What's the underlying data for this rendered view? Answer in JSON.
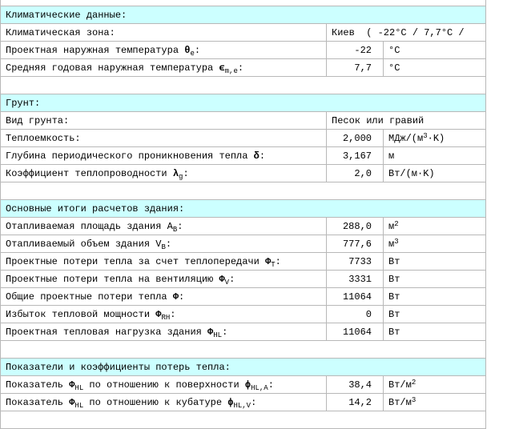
{
  "sections": [
    {
      "title": "Климатические данные:",
      "rows": [
        {
          "label": "Климатическая зона:",
          "span_value": "Киев  ( -22°C / 7,7°C /"
        },
        {
          "label": "Проектная наружная температура ",
          "sym": "θ",
          "sub": "e",
          "suffix": ":",
          "value": "-22",
          "unit": "°C"
        },
        {
          "label": "Средняя годовая наружная температура ",
          "sym": "ϵ",
          "sub": "m,e",
          "suffix": ":",
          "value": "7,7",
          "unit": "°C"
        }
      ]
    },
    {
      "title": "Грунт:",
      "rows": [
        {
          "label": "Вид грунта:",
          "span_value": "Песок или гравий"
        },
        {
          "label": "Теплоемкость:",
          "value": "2,000",
          "unit": "МДж/(м",
          "unit_sup": "3",
          "unit_tail": "·K)"
        },
        {
          "label": "Глубина периодического проникновения тепла ",
          "sym": "δ",
          "suffix": ":",
          "value": "3,167",
          "unit": "м"
        },
        {
          "label": "Коэффициент теплопроводности ",
          "sym": "λ",
          "sub": "g",
          "suffix": ":",
          "value": "2,0",
          "unit": "Вт/(м·K)"
        }
      ]
    },
    {
      "title": "Основные итоги расчетов здания:",
      "rows": [
        {
          "label": "Отапливаемая площадь здания A",
          "sub": "B",
          "suffix": ":",
          "value": "288,0",
          "unit": "м",
          "unit_sup": "2"
        },
        {
          "label": "Отапливаемый объем здания V",
          "sub": "B",
          "suffix": ":",
          "value": "777,6",
          "unit": "м",
          "unit_sup": "3"
        },
        {
          "label": "Проектные потери тепла за счет теплопередачи ",
          "sym": "Φ",
          "sub": "T",
          "suffix": ":",
          "value": "7733",
          "unit": "Вт"
        },
        {
          "label": "Проектные потери тепла на вентиляцию ",
          "sym": "Φ",
          "sub": "V",
          "suffix": ":",
          "value": "3331",
          "unit": "Вт"
        },
        {
          "label": "Общие проектные потери тепла ",
          "sym": "Φ",
          "suffix": ":",
          "value": "11064",
          "unit": "Вт"
        },
        {
          "label": "Избыток тепловой мощности ",
          "sym": "Φ",
          "sub": "RH",
          "suffix": ":",
          "value": "0",
          "unit": "Вт"
        },
        {
          "label": "Проектная тепловая нагрузка здания ",
          "sym": "Φ",
          "sub": "HL",
          "suffix": ":",
          "value": "11064",
          "unit": "Вт"
        }
      ]
    },
    {
      "title": "Показатели и коэффициенты потерь тепла:",
      "rows": [
        {
          "label": "Показатель ",
          "sym": "Φ",
          "sub": "HL",
          "suffix": " по отношению к поверхности ",
          "sym2": "ɸ",
          "sub2": "HL,A",
          "suffix2": ":",
          "value": "38,4",
          "unit": "Вт/м",
          "unit_sup": "2"
        },
        {
          "label": "Показатель ",
          "sym": "Φ",
          "sub": "HL",
          "suffix": " по отношению к кубатуре ",
          "sym2": "ɸ",
          "sub2": "HL,V",
          "suffix2": ":",
          "value": "14,2",
          "unit": "Вт/м",
          "unit_sup": "3"
        }
      ]
    }
  ]
}
